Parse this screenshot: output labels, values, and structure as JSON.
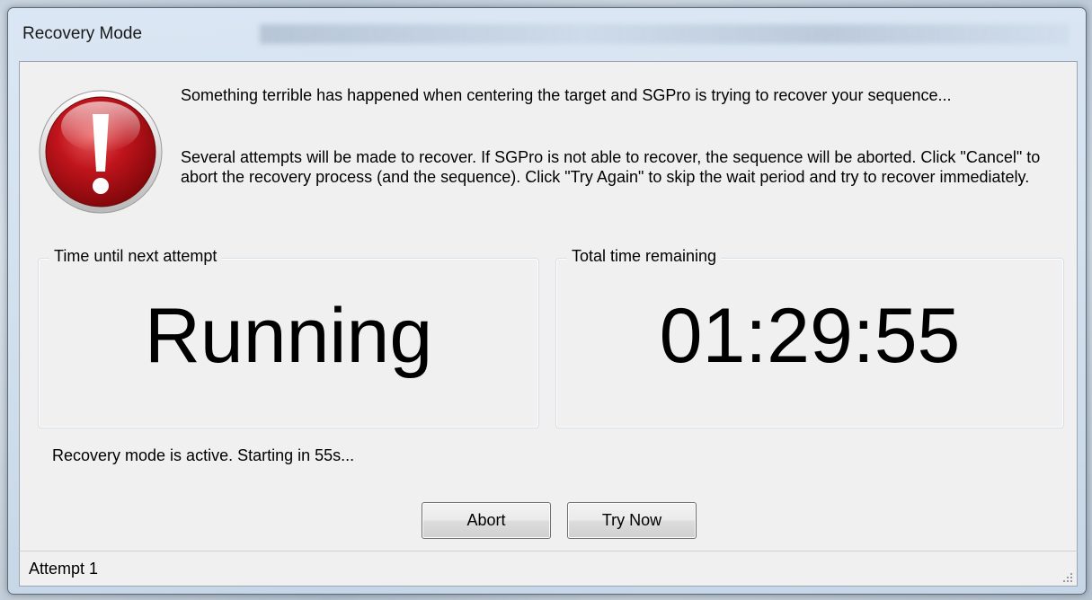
{
  "window": {
    "title": "Recovery Mode"
  },
  "message": {
    "line1": "Something terrible has happened when centering the target and SGPro is trying to recover your sequence...",
    "line2": "Several attempts will be made to recover.  If SGPro is not able to recover, the sequence will be aborted.  Click \"Cancel\" to abort the recovery process (and the sequence).  Click \"Try Again\" to skip the wait period and try to recover immediately."
  },
  "next_attempt": {
    "label": "Time until next attempt",
    "value": "Running"
  },
  "total_remaining": {
    "label": "Total time remaining",
    "value": "01:29:55"
  },
  "status": {
    "text": "Recovery mode is active.  Starting in 55s..."
  },
  "buttons": {
    "abort": "Abort",
    "try_now": "Try Now"
  },
  "statusbar": {
    "text": "Attempt 1"
  },
  "icons": {
    "error": "error-icon",
    "grip": "resize-grip-icon"
  },
  "colors": {
    "error_red": "#c0141c",
    "client_bg": "#f0f0f0"
  }
}
